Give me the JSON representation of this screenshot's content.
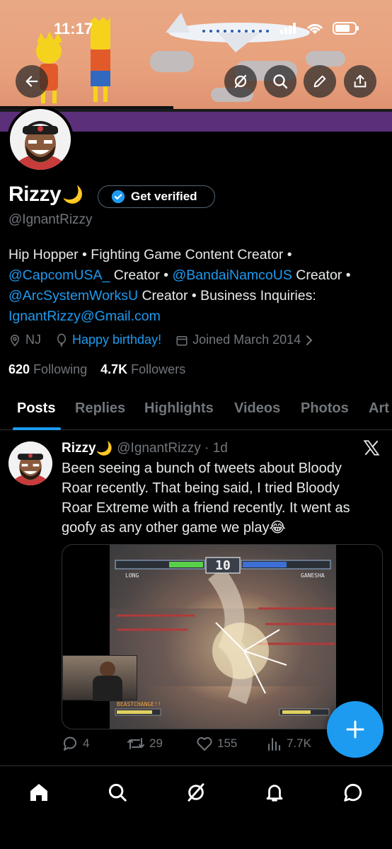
{
  "status_bar": {
    "time": "11:17"
  },
  "profile": {
    "name": "Rizzy",
    "name_emoji": "🌙",
    "handle": "@IgnantRizzy",
    "get_verified_label": "Get verified",
    "bio": {
      "line1": "Hip Hopper • Fighting Game Content Creator •",
      "mention1": "@CapcomUSA_",
      "after1": " Creator • ",
      "mention2": "@BandaiNamcoUS",
      "after2": " Creator •",
      "mention3": "@ArcSystemWorksU",
      "after3": " Creator • Business Inquiries:",
      "email": "IgnantRizzy@Gmail.com"
    },
    "location": "NJ",
    "birthday": "Happy birthday!",
    "joined": "Joined March 2014",
    "following_count": "620",
    "following_label": "Following",
    "followers_count": "4.7K",
    "followers_label": "Followers"
  },
  "tabs": [
    "Posts",
    "Replies",
    "Highlights",
    "Videos",
    "Photos",
    "Art"
  ],
  "active_tab": "Posts",
  "post": {
    "name": "Rizzy",
    "name_emoji": "🌙",
    "handle_time": "@IgnantRizzy · 1d",
    "text": "Been seeing a bunch of tweets about Bloody Roar recently. That being said, I tried Bloody Roar Extreme with a friend recently. It went as goofy as any other game we play",
    "text_emoji": "😂",
    "media": {
      "timer": "10",
      "p1_name": "LONG",
      "p2_name": "GANESHA",
      "beast_label": "BEASTCHANGE!!"
    },
    "replies": "4",
    "reposts": "29",
    "likes": "155",
    "views": "7.7K"
  },
  "colors": {
    "accent": "#1d9bf0",
    "muted": "#71767b",
    "background": "#000000"
  },
  "icons": {
    "banner_buttons": [
      "back-arrow-icon",
      "grok-icon",
      "search-icon",
      "edit-icon",
      "share-icon"
    ],
    "bottom_nav": [
      "home-icon",
      "search-icon",
      "grok-icon",
      "notifications-icon",
      "messages-icon"
    ]
  }
}
